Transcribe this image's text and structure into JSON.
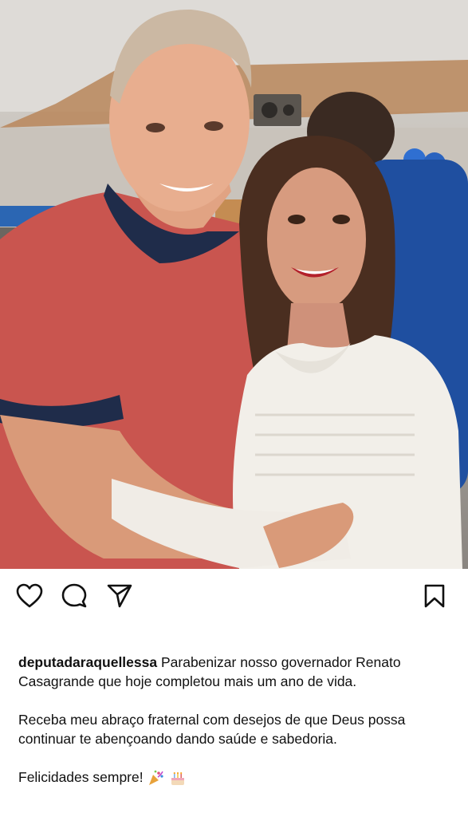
{
  "post": {
    "username": "deputadaraquellessa",
    "caption_line1": "Parabenizar nosso governador Renato Casagrande que hoje completou mais um ano de vida.",
    "caption_para2": "Receba meu abraço fraternal com desejos de que Deus possa continuar te abençoando dando saúde e sabedoria.",
    "caption_para3": "Felicidades sempre!"
  },
  "icons": {
    "like": "heart-icon",
    "comment": "comment-icon",
    "share": "send-icon",
    "save": "bookmark-icon",
    "emoji1": "party-popper-icon",
    "emoji2": "birthday-cake-icon"
  },
  "colors": {
    "text": "#111111",
    "background": "#ffffff",
    "shirt_red": "#c9554f",
    "blouse_white": "#f2efe9",
    "lipstick": "#b3202a"
  }
}
